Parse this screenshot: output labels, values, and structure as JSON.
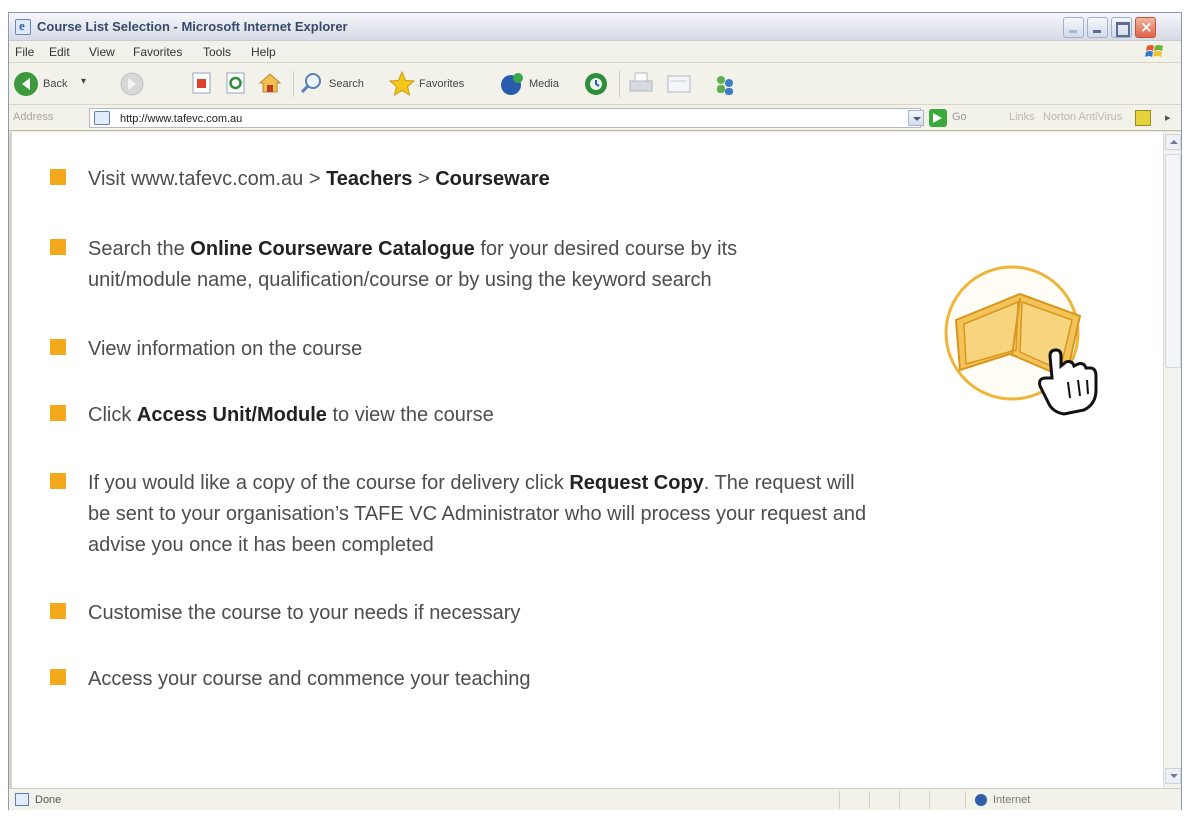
{
  "window": {
    "title": "Course List Selection - Microsoft Internet Explorer"
  },
  "menu": {
    "items": [
      "File",
      "Edit",
      "View",
      "Favorites",
      "Tools",
      "Help"
    ]
  },
  "toolbar": {
    "back_label": "Back",
    "search_label": "Search",
    "favorites_label": "Favorites",
    "media_label": "Media"
  },
  "address": {
    "label": "Address",
    "url": "http://www.tafevc.com.au",
    "go_label": "Go",
    "links_label": "Links",
    "norton_label": "Norton AntiVirus"
  },
  "content": {
    "steps": [
      {
        "pre": "Visit www.tafevc.com.au > ",
        "b1": "Teachers",
        "mid": " > ",
        "b2": "Courseware",
        "post": ""
      },
      {
        "pre": "Search the ",
        "b1": "Online Courseware Catalogue",
        "mid": " for your desired course by its",
        "line2": "unit/module name, qualification/course or by using the keyword search"
      },
      {
        "pre": "View information on the course"
      },
      {
        "pre": "Click ",
        "b1": "Access Unit/Module",
        "mid": " to view the course"
      },
      {
        "pre": "If you would like a copy of the course for delivery click ",
        "b1": "Request Copy",
        "mid": ". The request will",
        "line2": "be sent to your organisation’s TAFE VC Administrator who will process your request and",
        "line3": "advise you once it has been completed"
      },
      {
        "pre": "Customise the course to your needs if necessary"
      },
      {
        "pre": "Access your course and commence your teaching"
      }
    ]
  },
  "status": {
    "text": "Done",
    "zone": "Internet"
  },
  "colors": {
    "bullet": "#f4a81c",
    "illustration": "#efb43a"
  }
}
